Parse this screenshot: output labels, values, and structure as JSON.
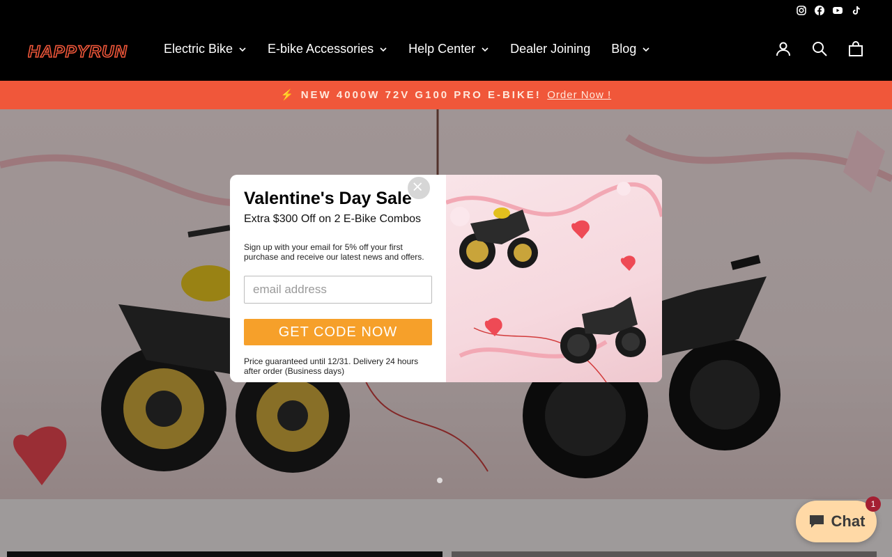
{
  "brand": {
    "logo_text": "HAPPYRUN",
    "accent": "#f0573a"
  },
  "social": [
    "instagram-icon",
    "facebook-icon",
    "youtube-icon",
    "tiktok-icon"
  ],
  "nav": {
    "items": [
      {
        "label": "Electric Bike",
        "has_dropdown": true
      },
      {
        "label": "E-bike Accessories",
        "has_dropdown": true
      },
      {
        "label": "Help Center",
        "has_dropdown": true
      },
      {
        "label": "Dealer Joining",
        "has_dropdown": false
      },
      {
        "label": "Blog",
        "has_dropdown": true
      }
    ],
    "icons": [
      "account-icon",
      "search-icon",
      "cart-icon"
    ]
  },
  "promo": {
    "text": "⚡ NEW 4000W 72V G100 PRO E-BIKE!",
    "link": "Order Now !"
  },
  "modal": {
    "title": "Valentine's Day Sale",
    "subtitle": "Extra $300 Off on 2 E-Bike Combos",
    "description": "Sign up with your email for 5% off your first purchase and receive our latest news and offers.",
    "email_placeholder": "email address",
    "button_label": "GET CODE NOW",
    "note": "Price guaranteed until 12/31. Delivery 24 hours after order (Business days)",
    "button_color": "#f6a02a"
  },
  "chat": {
    "label": "Chat",
    "badge_count": "1"
  }
}
